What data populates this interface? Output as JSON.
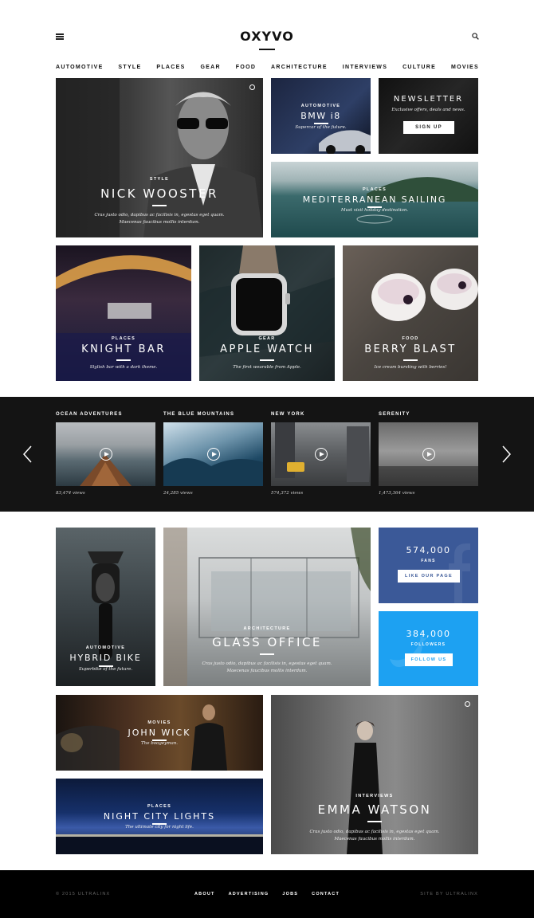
{
  "header": {
    "logo": "OXYVO",
    "menu_icon": "hamburger-icon",
    "search_icon": "search-icon"
  },
  "nav": [
    "AUTOMOTIVE",
    "STYLE",
    "PLACES",
    "GEAR",
    "FOOD",
    "ARCHITECTURE",
    "INTERVIEWS",
    "CULTURE",
    "MOVIES"
  ],
  "featured": {
    "nick": {
      "category": "STYLE",
      "title": "NICK WOOSTER",
      "desc1": "Cras justo odio, dapibus ac facilisis in, egestas eget quam.",
      "desc2": "Maecenas faucibus mollis interdum."
    },
    "bmw": {
      "category": "AUTOMOTIVE",
      "title": "BMW i8",
      "desc": "Supercar of the future."
    },
    "newsletter": {
      "title": "NEWSLETTER",
      "desc": "Exclusive offers, deals and news.",
      "button": "SIGN UP"
    },
    "sailing": {
      "category": "PLACES",
      "title": "MEDITERRANEAN SAILING",
      "desc": "Must visit holiday destination."
    }
  },
  "row2": [
    {
      "category": "PLACES",
      "title": "KNIGHT BAR",
      "desc": "Stylish bar with a dark theme."
    },
    {
      "category": "GEAR",
      "title": "APPLE WATCH",
      "desc": "The first wearable from Apple."
    },
    {
      "category": "FOOD",
      "title": "BERRY BLAST",
      "desc": "Ice cream bursting with berries!"
    }
  ],
  "videos": [
    {
      "title": "OCEAN ADVENTURES",
      "views": "83,474 views"
    },
    {
      "title": "THE BLUE MOUNTAINS",
      "views": "24,285 views"
    },
    {
      "title": "NEW YORK",
      "views": "574,372 views"
    },
    {
      "title": "SERENITY",
      "views": "1,473,364 views"
    }
  ],
  "row3": {
    "bike": {
      "category": "AUTOMOTIVE",
      "title": "HYBRID BIKE",
      "desc": "Superbike of the future."
    },
    "office": {
      "category": "ARCHITECTURE",
      "title": "GLASS OFFICE",
      "desc1": "Cras justo odio, dapibus ac facilisis in, egestas eget quam.",
      "desc2": "Maecenas faucibus mollis interdum."
    },
    "facebook": {
      "count": "574,000",
      "label": "FANS",
      "button": "LIKE OUR PAGE",
      "color": "#3b5998"
    },
    "twitter": {
      "count": "384,000",
      "label": "FOLLOWERS",
      "button": "FOLLOW US",
      "color": "#1da1f2"
    }
  },
  "row4": {
    "wick": {
      "category": "MOVIES",
      "title": "JOHN WICK",
      "desc": "The boogeyman."
    },
    "city": {
      "category": "PLACES",
      "title": "NIGHT CITY LIGHTS",
      "desc": "The ultimate city for night life."
    },
    "emma": {
      "category": "INTERVIEWS",
      "title": "EMMA WATSON",
      "desc1": "Cras justo odio, dapibus ac facilisis in, egestas eget quam.",
      "desc2": "Maecenas faucibus mollis interdum."
    }
  },
  "footer": {
    "copyright": "© 2015 ULTRALINX",
    "links": [
      "ABOUT",
      "ADVERTISING",
      "JOBS",
      "CONTACT"
    ],
    "credit": "SITE BY ULTRALINX"
  }
}
